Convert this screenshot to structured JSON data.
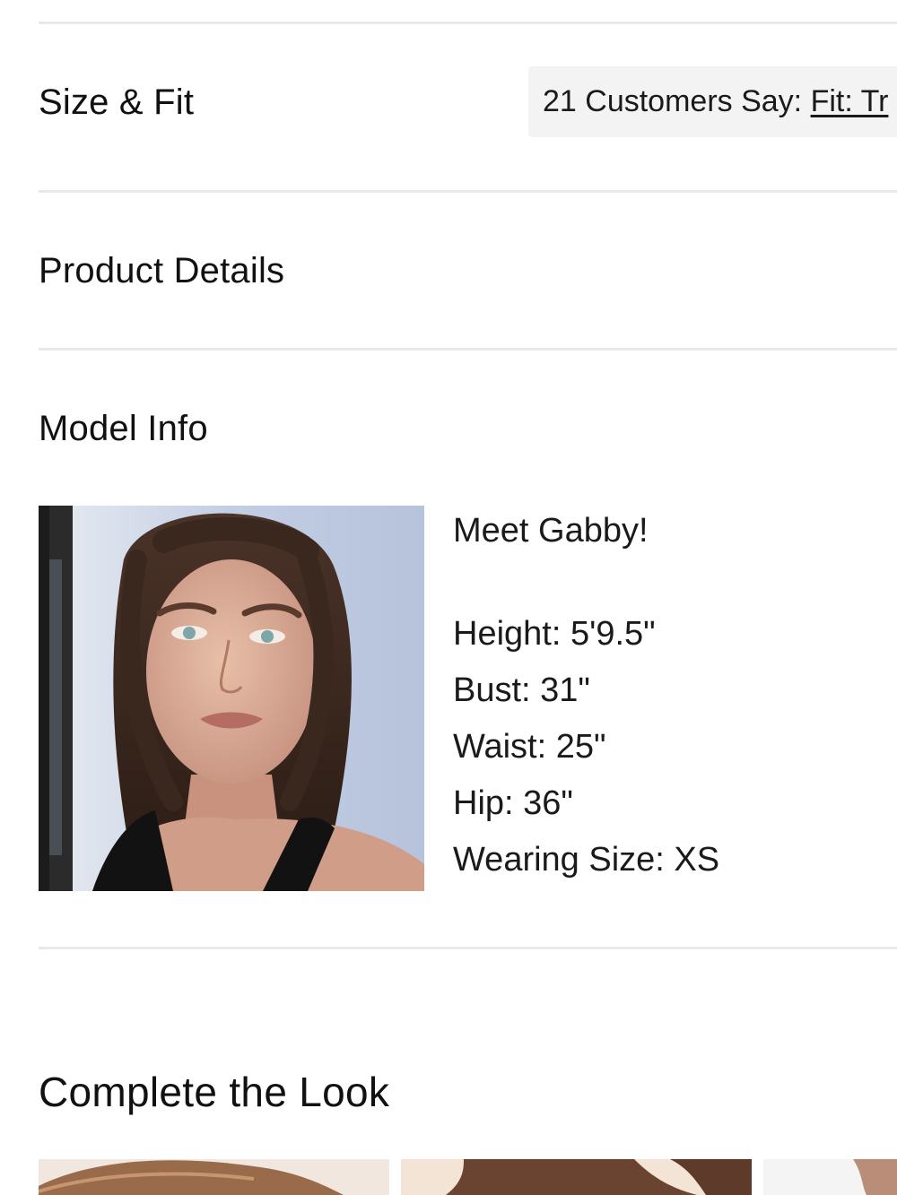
{
  "sections": {
    "size_fit": {
      "title": "Size & Fit",
      "summary_prefix": "21 Customers Say: ",
      "summary_link": "Fit: Tr"
    },
    "product_details": {
      "title": "Product Details"
    },
    "model_info": {
      "title": "Model Info",
      "greeting": "Meet Gabby!",
      "stats": [
        "Height: 5'9.5\"",
        "Bust: 31\"",
        "Waist: 25\"",
        "Hip: 36\"",
        "Wearing Size: XS"
      ]
    }
  },
  "complete_the_look": {
    "title": "Complete the Look"
  },
  "colors": {
    "divider": "#e9e9e9",
    "pill_background": "#f3f3f3",
    "text": "#1a1a1a"
  }
}
